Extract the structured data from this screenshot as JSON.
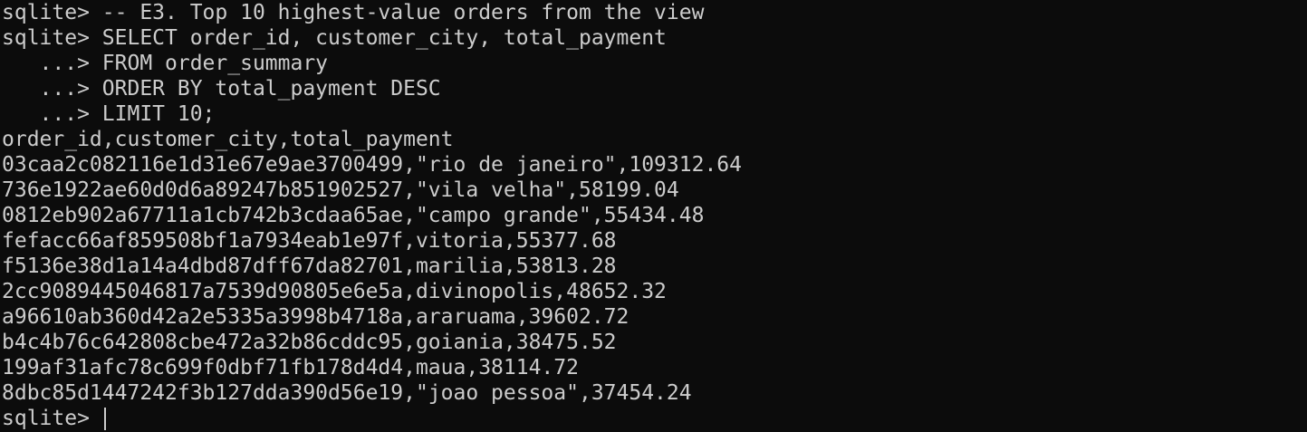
{
  "terminal": {
    "lines": [
      "sqlite> -- E3. Top 10 highest-value orders from the view",
      "sqlite> SELECT order_id, customer_city, total_payment",
      "   ...> FROM order_summary",
      "   ...> ORDER BY total_payment DESC",
      "   ...> LIMIT 10;",
      "order_id,customer_city,total_payment",
      "03caa2c082116e1d31e67e9ae3700499,\"rio de janeiro\",109312.64",
      "736e1922ae60d0d6a89247b851902527,\"vila velha\",58199.04",
      "0812eb902a67711a1cb742b3cdaa65ae,\"campo grande\",55434.48",
      "fefacc66af859508bf1a7934eab1e97f,vitoria,55377.68",
      "f5136e38d1a14a4dbd87dff67da82701,marilia,53813.28",
      "2cc9089445046817a7539d90805e6e5a,divinopolis,48652.32",
      "a96610ab360d42a2e5335a3998b4718a,araruama,39602.72",
      "b4c4b76c642808cbe472a32b86cddc95,goiania,38475.52",
      "199af31afc78c699f0dbf71fb178d4d4,maua,38114.72",
      "8dbc85d1447242f3b127dda390d56e19,\"joao pessoa\",37454.24"
    ],
    "prompt": "sqlite> "
  },
  "colors": {
    "background": "#0c0c0c",
    "foreground": "#cccccc"
  }
}
